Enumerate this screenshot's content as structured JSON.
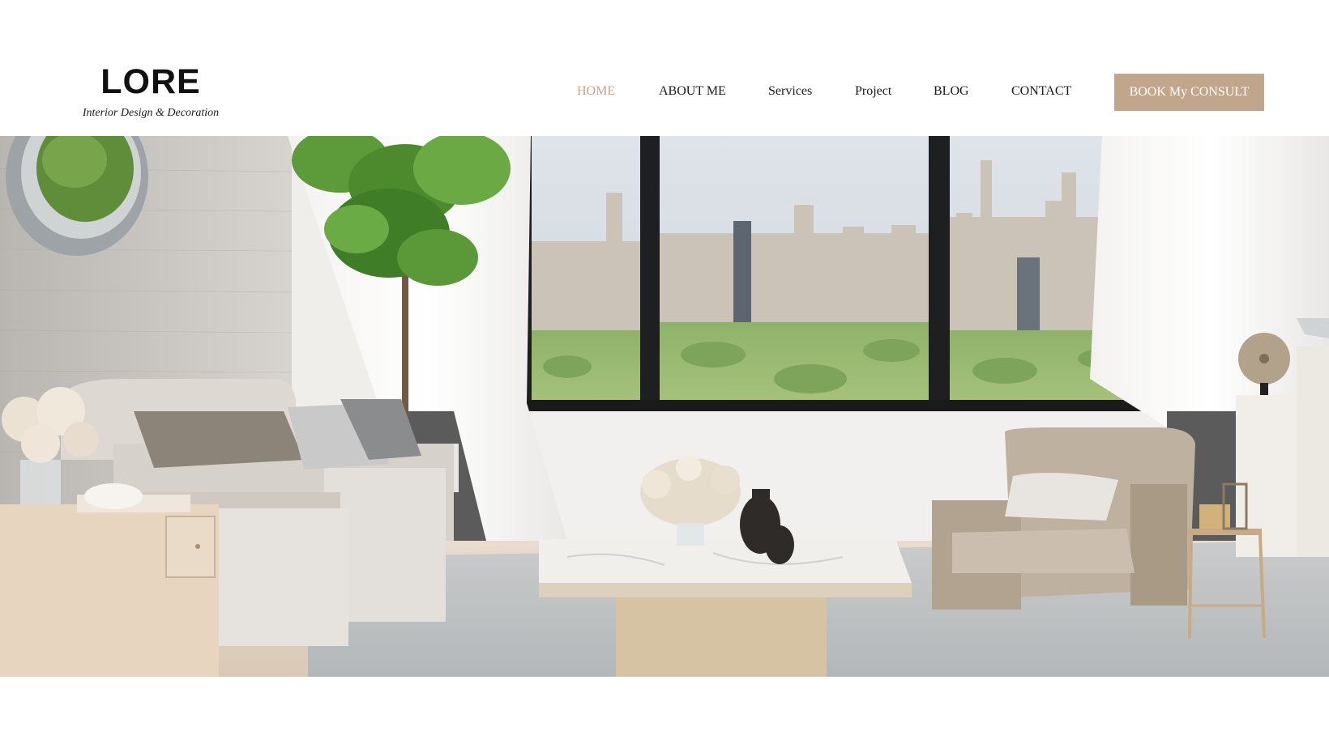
{
  "header": {
    "logo": {
      "mark": "LORE",
      "tagline": "Interior Design & Decoration"
    },
    "nav": [
      {
        "label": "HOME",
        "active": true
      },
      {
        "label": "ABOUT ME",
        "active": false
      },
      {
        "label": "Services",
        "active": false
      },
      {
        "label": "Project",
        "active": false
      },
      {
        "label": "BLOG",
        "active": false
      },
      {
        "label": "CONTACT",
        "active": false
      }
    ],
    "cta_label": "BOOK My CONSULT"
  },
  "hero": {
    "image_subject": "living-room-interior-photo"
  },
  "colors": {
    "accent": "#c1a68b",
    "active_nav": "#c2a48a",
    "text": "#1a1a1a"
  }
}
